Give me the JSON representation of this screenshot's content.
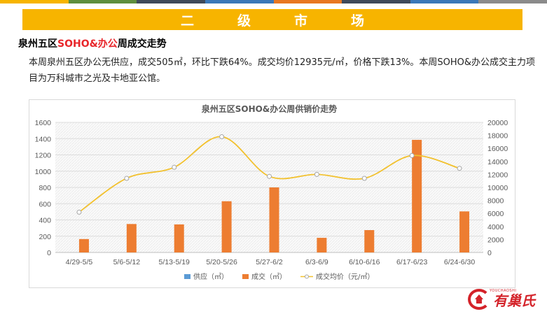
{
  "header": {
    "stripe_colors": [
      "#f7b400",
      "#5f8f3e",
      "#3f4a5a",
      "#3b78b8",
      "#e87722",
      "#3f4a5a",
      "#3b78b8",
      "#8b8b8b"
    ],
    "banner_title": "二级市场",
    "banner_color": "#f7b400"
  },
  "subtitle": {
    "prefix": "泉州五区",
    "highlight": "SOHO&办公",
    "suffix": "周成交走势",
    "highlight_color": "#e8262b"
  },
  "paragraph": "本周泉州五区办公无供应，成交505㎡，环比下跌64%。成交均价12935元/㎡，价格下跌13%。本周SOHO&办公成交主力项目为万科城市之光及卡地亚公馆。",
  "logo": {
    "text": "有巢氏",
    "small_text": "YOUCHAOSHI",
    "color": "#d4232a"
  },
  "chart_data": {
    "type": "bar",
    "title": "泉州五区SOHO&办公周供销价走势",
    "categories": [
      "4/29-5/5",
      "5/6-5/12",
      "5/13-5/19",
      "5/20-5/26",
      "5/27-6/2",
      "6/3-6/9",
      "6/10-6/16",
      "6/17-6/23",
      "6/24-6/30"
    ],
    "series": [
      {
        "name": "供应（㎡）",
        "type": "bar",
        "axis": "left",
        "color": "#5b9bd5",
        "values": [
          0,
          0,
          0,
          0,
          0,
          0,
          0,
          0,
          0
        ]
      },
      {
        "name": "成交（㎡）",
        "type": "bar",
        "axis": "left",
        "color": "#ed7d31",
        "values": [
          165,
          350,
          345,
          630,
          800,
          180,
          275,
          1385,
          505
        ]
      },
      {
        "name": "成交均价（元/㎡）",
        "type": "line",
        "axis": "right",
        "color": "#f2c12e",
        "values": [
          6200,
          11400,
          13100,
          17800,
          11700,
          12000,
          11400,
          14900,
          12935
        ]
      }
    ],
    "y_left": {
      "min": 0,
      "max": 1600,
      "ticks": [
        "0",
        "200",
        "400",
        "600",
        "800",
        "1000",
        "1200",
        "1400",
        "1600"
      ]
    },
    "y_right": {
      "min": 0,
      "max": 20000,
      "ticks": [
        "0",
        "2000",
        "4000",
        "6000",
        "8000",
        "10000",
        "12000",
        "14000",
        "16000",
        "18000",
        "20000"
      ]
    },
    "legend_position": "bottom",
    "grid": true
  }
}
